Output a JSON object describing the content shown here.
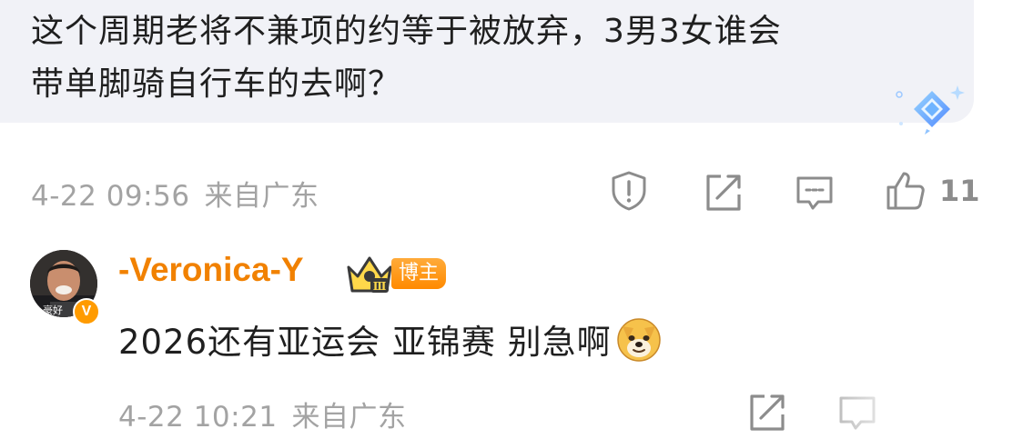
{
  "comment": {
    "text": "这个周期老将不兼项的约等于被放弃，3男3女谁会\n带单脚骑自行车的去啊？",
    "date": "4-22 09:56",
    "location": "来自广东",
    "like_count": "11",
    "actions": [
      "report-icon",
      "share-icon",
      "reply-icon",
      "like-icon"
    ]
  },
  "reply": {
    "username": "-Veronica-Y",
    "blogger_tag": "博主",
    "avatar_caption": "豪好",
    "verified_glyph": "V",
    "crown_level": "Ⅲ",
    "text": "2026还有亚运会 亚锦赛 别急啊",
    "emoji": "doge-emoji",
    "date": "4-22 10:21",
    "location": "来自广东"
  },
  "colors": {
    "bubble_bg": "#f1f2f7",
    "username": "#f18100",
    "meta_text": "#a3a3a3",
    "icon": "#8c8c8c",
    "badge": "#ff9b00"
  }
}
